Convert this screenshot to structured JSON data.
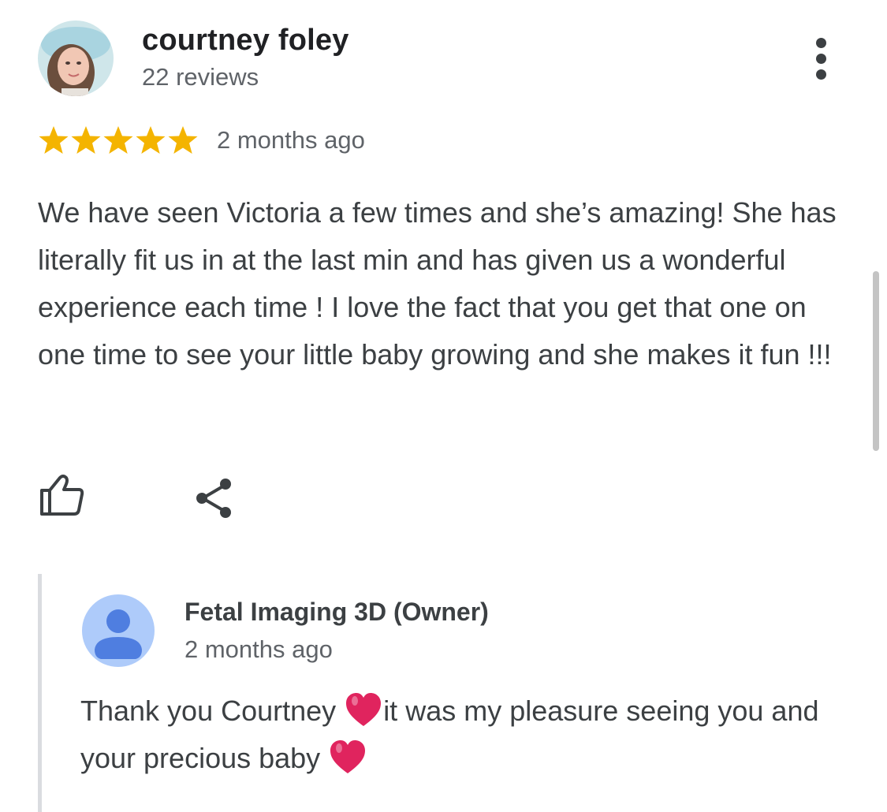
{
  "review": {
    "author_name": "courtney foley",
    "review_count": "22 reviews",
    "rating": 5,
    "rating_max": 5,
    "star_color": "#f4b400",
    "date": "2 months ago",
    "text": "We have seen Victoria a few times and she’s amazing! She has literally fit us in at the last min and has given us a wonderful experience each time ! I love the fact that you get that one on one time to see your little baby growing and she makes it fun !!!",
    "icons": {
      "more": "more-vert-icon",
      "like": "thumbs-up-icon",
      "share": "share-icon"
    }
  },
  "owner_reply": {
    "author_name": "Fetal Imaging 3D (Owner)",
    "date": "2 months ago",
    "text_part1": "Thank you Courtney ",
    "text_part2": "it was my pleasure seeing you and your precious baby ",
    "emoji": "heart-emoji",
    "heart_color": "#e0245e",
    "avatar_color": "#aecbfa",
    "avatar_figure_color": "#4f7ee0"
  }
}
